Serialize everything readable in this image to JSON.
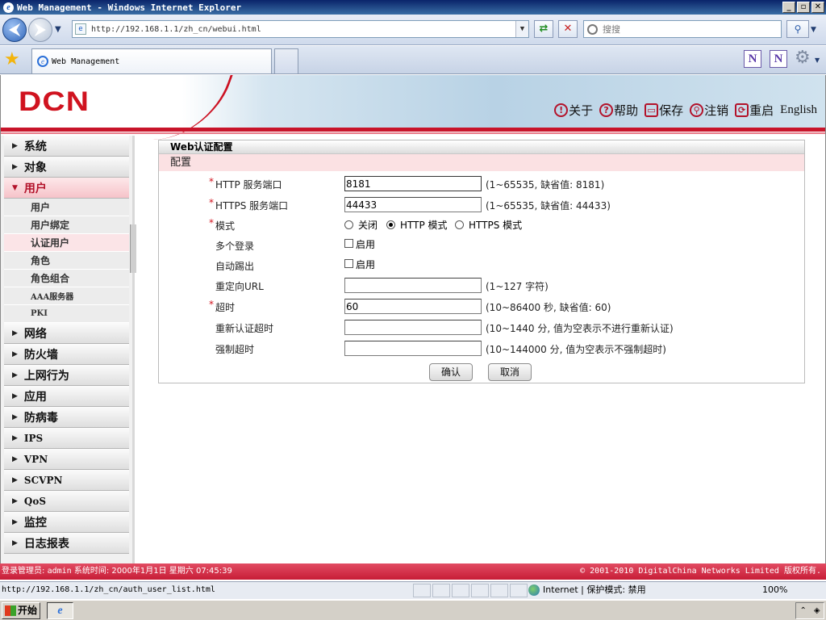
{
  "window": {
    "title": "Web Management - Windows Internet Explorer",
    "controls": [
      "_",
      "▫",
      "✕"
    ]
  },
  "browser": {
    "address": "http://192.168.1.1/zh_cn/webui.html",
    "search_placeholder": "搜搜",
    "tab_title": "Web Management",
    "status_url": "http://192.168.1.1/zh_cn/auth_user_list.html",
    "zone": "Internet | 保护模式: 禁用",
    "zoom": "100%",
    "tool_n1": "N",
    "tool_n2": "N"
  },
  "header": {
    "logo": "DCN",
    "links": [
      {
        "icon": "info-icon",
        "glyph": "!",
        "label": "关于"
      },
      {
        "icon": "help-icon",
        "glyph": "?",
        "label": "帮助"
      },
      {
        "icon": "save-icon",
        "glyph": "▭",
        "label": "保存"
      },
      {
        "icon": "logout-icon",
        "glyph": "⚲",
        "label": "注销"
      },
      {
        "icon": "restart-icon",
        "glyph": "⟳",
        "label": "重启"
      }
    ],
    "english": "English"
  },
  "sidebar": {
    "menus_before": [
      "系统",
      "对象"
    ],
    "active_menu": "用户",
    "sub_items": [
      "用户",
      "用户绑定",
      "认证用户",
      "角色",
      "角色组合",
      "AAA服务器",
      "PKI"
    ],
    "selected_sub": "认证用户",
    "menus_after": [
      "网络",
      "防火墙",
      "上网行为",
      "应用",
      "防病毒",
      "IPS",
      "VPN",
      "SCVPN",
      "QoS",
      "监控",
      "日志报表"
    ]
  },
  "panel": {
    "title": "Web认证配置",
    "section": "配置",
    "fields": {
      "http_port": {
        "label": "HTTP 服务端口",
        "value": "8181",
        "hint": "(1~65535, 缺省值: 8181)"
      },
      "https_port": {
        "label": "HTTPS 服务端口",
        "value": "44433",
        "hint": "(1~65535, 缺省值: 44433)"
      },
      "mode": {
        "label": "模式",
        "options": [
          "关闭",
          "HTTP 模式",
          "HTTPS 模式"
        ],
        "selected": "HTTP 模式"
      },
      "multi_login": {
        "label": "多个登录",
        "checkbox_label": "启用",
        "checked": false
      },
      "auto_kick": {
        "label": "自动踢出",
        "checkbox_label": "启用",
        "checked": false
      },
      "redirect_url": {
        "label": "重定向URL",
        "value": "",
        "hint": "(1~127 字符)"
      },
      "timeout": {
        "label": "超时",
        "value": "60",
        "hint": "(10~86400 秒, 缺省值: 60)"
      },
      "reauth_timeout": {
        "label": "重新认证超时",
        "value": "",
        "hint": "(10~1440 分, 值为空表示不进行重新认证)"
      },
      "force_timeout": {
        "label": "强制超时",
        "value": "",
        "hint": "(10~144000 分, 值为空表示不强制超时)"
      }
    },
    "confirm_label": "确认",
    "cancel_label": "取消"
  },
  "footer": {
    "admin_label": "登录管理员:",
    "admin": "admin",
    "time_label": "系统时间:",
    "time": "2000年1月1日 星期六 07:45:39",
    "copyright": "© 2001-2010 DigitalChina Networks Limited 版权所有."
  },
  "taskbar": {
    "start": "开始"
  },
  "colors": {
    "brand_red": "#c8142a",
    "active_bg": "#fbe4e7",
    "required_star": "#d2141f"
  }
}
